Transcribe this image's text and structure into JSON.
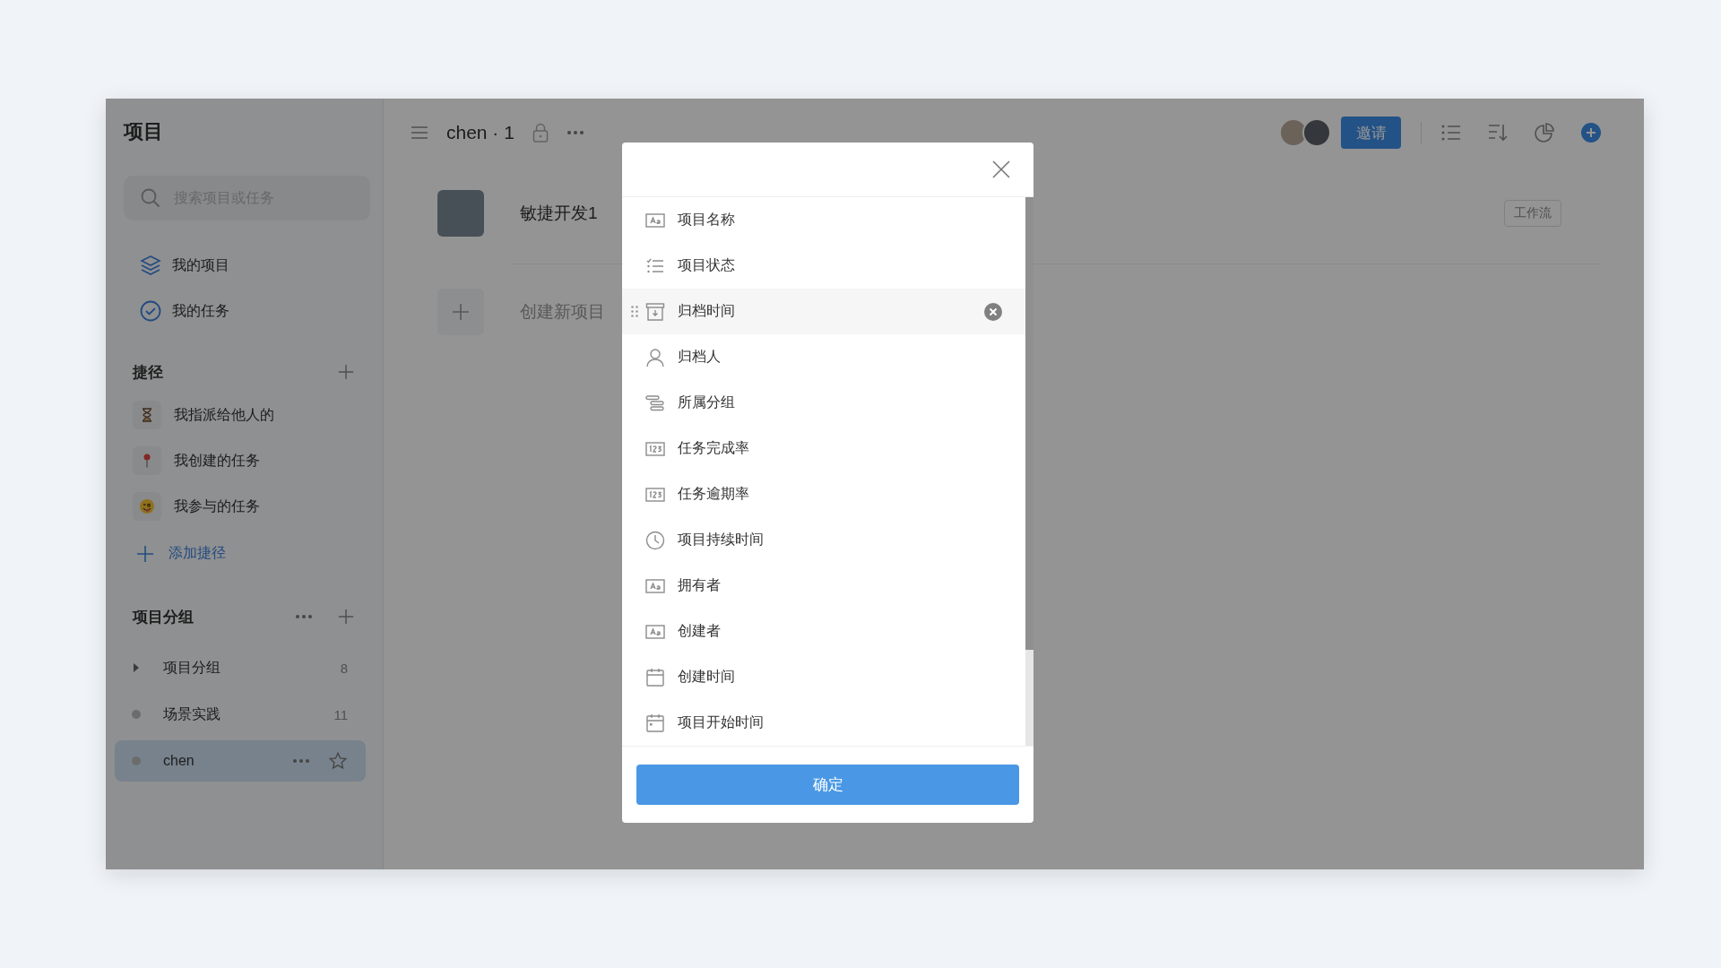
{
  "sidebar": {
    "title": "项目",
    "search": {
      "placeholder": "搜索项目或任务"
    },
    "nav": [
      {
        "label": "我的项目",
        "kind": "projects"
      },
      {
        "label": "我的任务",
        "kind": "tasks"
      }
    ],
    "shortcuts": {
      "title": "捷径",
      "items": [
        {
          "label": "我指派给他人的",
          "kind": "hourglass"
        },
        {
          "label": "我创建的任务",
          "kind": "pin"
        },
        {
          "label": "我参与的任务",
          "kind": "face"
        }
      ],
      "add_label": "添加捷径"
    },
    "groups": {
      "title": "项目分组",
      "items": [
        {
          "label": "项目分组",
          "kind": "folder",
          "count": "8",
          "selected": false
        },
        {
          "label": "场景实践",
          "kind": "project",
          "count": "11",
          "selected": false
        },
        {
          "label": "chen",
          "kind": "project",
          "selected": true
        }
      ]
    }
  },
  "header": {
    "title": "chen · 1",
    "invite_button": "邀请"
  },
  "projects": [
    {
      "name": "敏捷开发1",
      "tag": "工作流"
    }
  ],
  "create_label": "创建新项目",
  "dialog": {
    "fields": [
      {
        "label": "项目名称",
        "kind": "text",
        "hovered": false
      },
      {
        "label": "项目状态",
        "kind": "status",
        "hovered": false
      },
      {
        "label": "归档时间",
        "kind": "archive",
        "hovered": true
      },
      {
        "label": "归档人",
        "kind": "person",
        "hovered": false
      },
      {
        "label": "所属分组",
        "kind": "group",
        "hovered": false
      },
      {
        "label": "任务完成率",
        "kind": "number",
        "hovered": false
      },
      {
        "label": "任务逾期率",
        "kind": "number",
        "hovered": false
      },
      {
        "label": "项目持续时间",
        "kind": "clock",
        "hovered": false
      },
      {
        "label": "拥有者",
        "kind": "text",
        "hovered": false
      },
      {
        "label": "创建者",
        "kind": "text",
        "hovered": false
      },
      {
        "label": "创建时间",
        "kind": "calendar",
        "hovered": false
      },
      {
        "label": "项目开始时间",
        "kind": "calendar-start",
        "hovered": false
      }
    ],
    "confirm_button": "确定"
  }
}
